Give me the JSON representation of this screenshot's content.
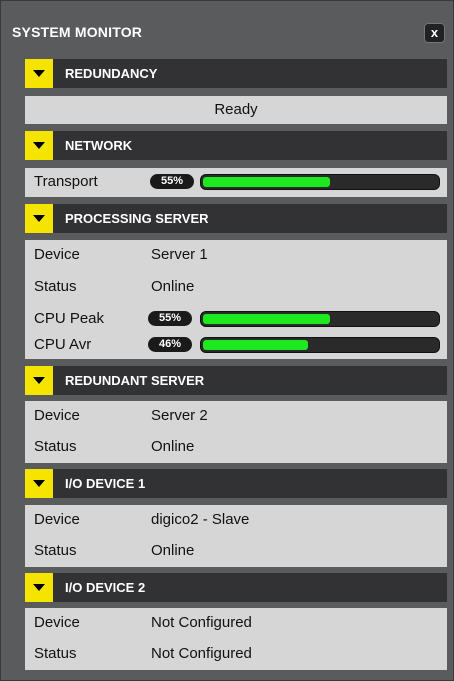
{
  "window": {
    "title": "SYSTEM MONITOR",
    "close_label": "x"
  },
  "sections": {
    "redundancy": {
      "header": "REDUNDANCY",
      "status": "Ready"
    },
    "network": {
      "header": "NETWORK",
      "transport_label": "Transport",
      "transport_pct": "55%",
      "transport_value": 55
    },
    "processing_server": {
      "header": "PROCESSING SERVER",
      "device_label": "Device",
      "device_value": "Server 1",
      "status_label": "Status",
      "status_value": "Online",
      "cpu_peak_label": "CPU Peak",
      "cpu_peak_pct": "55%",
      "cpu_peak_value": 55,
      "cpu_avr_label": "CPU Avr",
      "cpu_avr_pct": "46%",
      "cpu_avr_value": 46
    },
    "redundant_server": {
      "header": "REDUNDANT SERVER",
      "device_label": "Device",
      "device_value": "Server 2",
      "status_label": "Status",
      "status_value": "Online"
    },
    "io_device_1": {
      "header": "I/O DEVICE 1",
      "device_label": "Device",
      "device_value": "digico2 - Slave",
      "status_label": "Status",
      "status_value": "Online"
    },
    "io_device_2": {
      "header": "I/O DEVICE 2",
      "device_label": "Device",
      "device_value": "Not Configured",
      "status_label": "Status",
      "status_value": "Not Configured"
    }
  },
  "colors": {
    "accent": "#f4e400",
    "meter_fill": "#1ee81e",
    "header_bg": "#323234",
    "panel_bg": "#d6d6d6"
  },
  "icons": {
    "section_toggle": "chevron-down-icon",
    "close": "close-icon"
  }
}
